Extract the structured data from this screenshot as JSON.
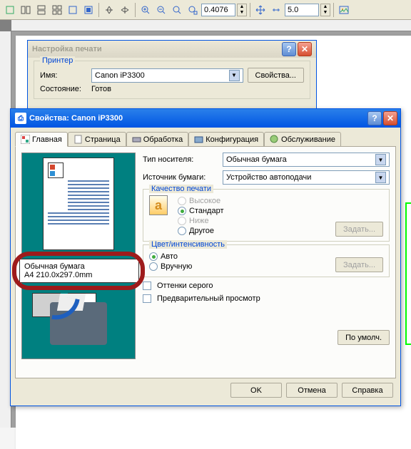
{
  "toolbar": {
    "zoom_value": "0.4076",
    "size_value": "5.0"
  },
  "print_setup": {
    "title": "Настройка печати",
    "printer_legend": "Принтер",
    "name_label": "Имя:",
    "printer_name": "Canon iP3300",
    "props_btn": "Свойства...",
    "state_label": "Состояние:",
    "state_value": "Готов"
  },
  "props": {
    "title": "Свойства: Canon iP3300",
    "tabs": {
      "main": "Главная",
      "page": "Страница",
      "processing": "Обработка",
      "config": "Конфигурация",
      "service": "Обслуживание"
    },
    "paper_label1": "Обычная бумага",
    "paper_label2": "A4 210.0x297.0mm",
    "media_type_label": "Тип носителя:",
    "media_type_value": "Обычная бумага",
    "source_label": "Источник бумаги:",
    "source_value": "Устройство автоподачи",
    "quality_legend": "Качество печати",
    "quality": {
      "high": "Высокое",
      "standard": "Стандарт",
      "low": "Ниже",
      "other": "Другое"
    },
    "set_btn": "Задать...",
    "color_legend": "Цвет/интенсивность",
    "color": {
      "auto": "Авто",
      "manual": "Вручную"
    },
    "grayscale": "Оттенки серого",
    "preview": "Предварительный просмотр",
    "defaults_btn": "По умолч.",
    "ok_btn": "OK",
    "cancel_btn": "Отмена",
    "help_btn": "Справка"
  }
}
